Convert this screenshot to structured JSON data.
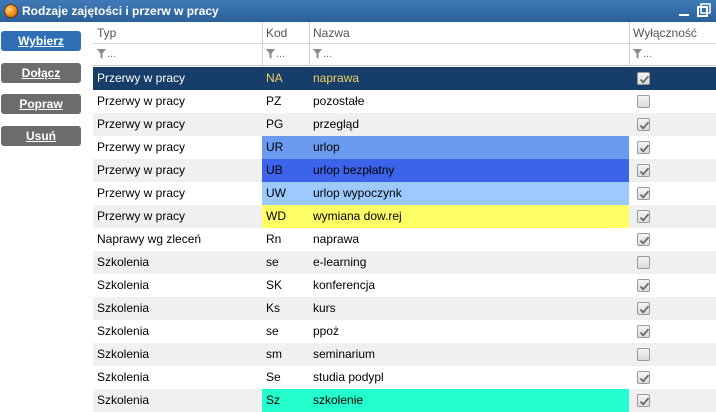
{
  "window": {
    "title": "Rodzaje zajętości i przerw w pracy"
  },
  "sidebar": {
    "buttons": [
      {
        "label": "Wybierz",
        "primary": true
      },
      {
        "label": "Dołącz"
      },
      {
        "label": "Popraw"
      },
      {
        "label": "Usuń"
      }
    ]
  },
  "grid": {
    "columns": [
      "Typ",
      "Kod",
      "Nazwa",
      "Wyłączność"
    ],
    "filter_placeholder": "...",
    "rows": [
      {
        "typ": "Przerwy w pracy",
        "kod": "NA",
        "nazwa": "naprawa",
        "checked": true,
        "selected": true
      },
      {
        "typ": "Przerwy w pracy",
        "kod": "PZ",
        "nazwa": "pozostałe",
        "checked": false
      },
      {
        "typ": "Przerwy w pracy",
        "kod": "PG",
        "nazwa": "przegląd",
        "checked": true
      },
      {
        "typ": "Przerwy w pracy",
        "kod": "UR",
        "nazwa": "urlop",
        "checked": true,
        "color": "#6b9bf0"
      },
      {
        "typ": "Przerwy w pracy",
        "kod": "UB",
        "nazwa": "urlop bezpłatny",
        "checked": true,
        "color": "#3c64ea"
      },
      {
        "typ": "Przerwy w pracy",
        "kod": "UW",
        "nazwa": "urlop wypoczynk",
        "checked": true,
        "color": "#9ccaff"
      },
      {
        "typ": "Przerwy w pracy",
        "kod": "WD",
        "nazwa": "wymiana dow.rej",
        "checked": true,
        "color": "#ffff66"
      },
      {
        "typ": "Naprawy wg zleceń",
        "kod": "Rn",
        "nazwa": "naprawa",
        "checked": true
      },
      {
        "typ": "Szkolenia",
        "kod": "se",
        "nazwa": "e-learning",
        "checked": false
      },
      {
        "typ": "Szkolenia",
        "kod": "SK",
        "nazwa": "konferencja",
        "checked": true
      },
      {
        "typ": "Szkolenia",
        "kod": "Ks",
        "nazwa": "kurs",
        "checked": true
      },
      {
        "typ": "Szkolenia",
        "kod": "se",
        "nazwa": "ppoż",
        "checked": true
      },
      {
        "typ": "Szkolenia",
        "kod": "sm",
        "nazwa": "seminarium",
        "checked": false
      },
      {
        "typ": "Szkolenia",
        "kod": "Se",
        "nazwa": "studia podypl",
        "checked": true
      },
      {
        "typ": "Szkolenia",
        "kod": "Sz",
        "nazwa": "szkolenie",
        "checked": true,
        "color": "#22ffcc"
      }
    ]
  },
  "colors": {
    "titlebar": "#2f6aa6",
    "selected_row": "#173e6b",
    "selected_code_text": "#f0d060"
  }
}
